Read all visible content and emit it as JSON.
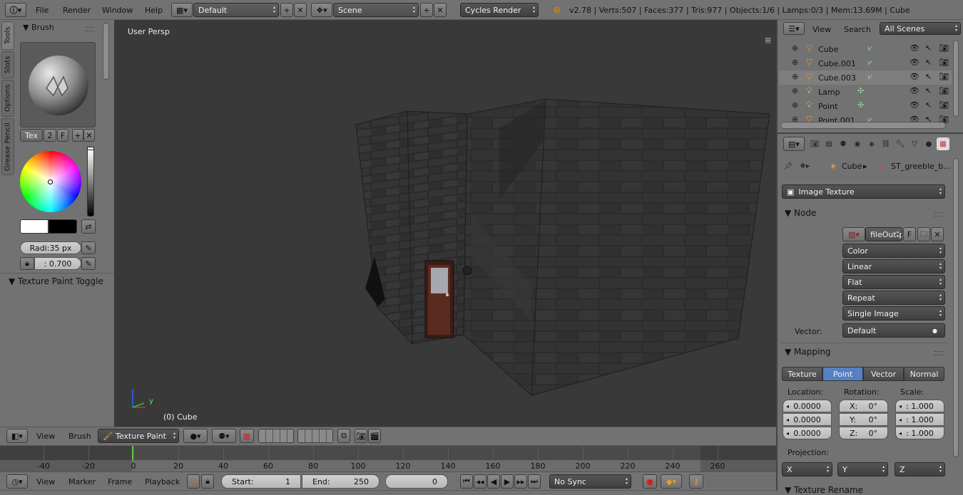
{
  "top_bar": {
    "menus": [
      "File",
      "Render",
      "Window",
      "Help"
    ],
    "layout": "Default",
    "scene": "Scene",
    "engine": "Cycles Render",
    "stats": "v2.78 | Verts:507 | Faces:377 | Tris:977 | Objects:1/6 | Lamps:0/3 | Mem:13.69M | Cube"
  },
  "tool_shelf": {
    "tabs": [
      "Tools",
      "Slots",
      "Options",
      "Grease Pencil"
    ],
    "brush_panel": "Brush",
    "tex_label": "Tex",
    "tex_users": "2",
    "tex_fake": "F",
    "radius": "Radi:35 px",
    "strength": ": 0.700",
    "toggle_panel": "Texture Paint Toggle"
  },
  "viewport": {
    "view_name": "User Persp",
    "object_label": "(0) Cube",
    "axis_y": "y"
  },
  "viewport_header": {
    "view": "View",
    "brush": "Brush",
    "mode": "Texture Paint"
  },
  "timeline": {
    "ticks": [
      "-40",
      "-20",
      "0",
      "20",
      "40",
      "60",
      "80",
      "100",
      "120",
      "140",
      "160",
      "180",
      "200",
      "220",
      "240",
      "260"
    ],
    "current_frame": 0
  },
  "timeline_header": {
    "menus": [
      "View",
      "Marker",
      "Frame",
      "Playback"
    ],
    "start": "Start:",
    "start_val": "1",
    "end": "End:",
    "end_val": "250",
    "frame": "0",
    "sync": "No Sync"
  },
  "outliner": {
    "view": "View",
    "search": "Search",
    "filter": "All Scenes",
    "items": [
      {
        "name": "Cube",
        "type": "mesh"
      },
      {
        "name": "Cube.001",
        "type": "mesh"
      },
      {
        "name": "Cube.003",
        "type": "mesh"
      },
      {
        "name": "Lamp",
        "type": "lamp"
      },
      {
        "name": "Point",
        "type": "lamp"
      },
      {
        "name": "Point.001",
        "type": "mesh"
      }
    ]
  },
  "properties": {
    "breadcrumb_object": "Cube",
    "breadcrumb_texture": "ST_greeble_b...",
    "texture_type": "Image Texture",
    "node_panel": "Node",
    "image_name": "fileOut.p",
    "image_fake": "F",
    "color": "Color",
    "interp": "Linear",
    "projection_mode": "Flat",
    "extension": "Repeat",
    "source": "Single Image",
    "vector_label": "Vector:",
    "vector_value": "Default",
    "mapping_panel": "Mapping",
    "mapping_tabs": [
      "Texture",
      "Point",
      "Vector",
      "Normal"
    ],
    "mapping_active": "Point",
    "location_label": "Location:",
    "rotation_label": "Rotation:",
    "scale_label": "Scale:",
    "location": [
      "0.0000",
      "0.0000",
      "0.0000"
    ],
    "rotation_x": "X:",
    "rotation_y": "Y:",
    "rotation_z": "Z:",
    "rotation_val": "0°",
    "scale": [
      ": 1.000",
      ": 1.000",
      ": 1.000"
    ],
    "projection_label": "Projection:",
    "proj_axes": [
      "X",
      "Y",
      "Z"
    ],
    "texture_rename": "Texture Rename"
  },
  "colors": {
    "accent": "#5680c2",
    "viewport_bg": "#393939",
    "playhead": "#5bcc3c"
  }
}
